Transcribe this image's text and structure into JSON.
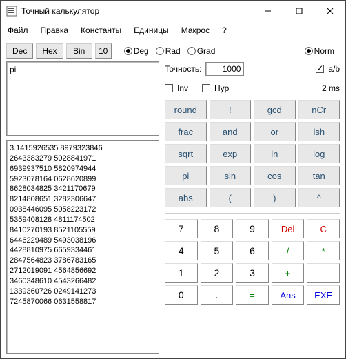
{
  "window": {
    "title": "Точный калькулятор"
  },
  "menu": [
    "Файл",
    "Правка",
    "Константы",
    "Единицы",
    "Макрос",
    "?"
  ],
  "modes": {
    "dec": "Dec",
    "hex": "Hex",
    "bin": "Bin",
    "base": "10"
  },
  "angle": {
    "deg": "Deg",
    "rad": "Rad",
    "grad": "Grad",
    "selected": "deg"
  },
  "norm": {
    "label": "Norm",
    "on": true
  },
  "precision": {
    "label": "Точность:",
    "value": "1000"
  },
  "ab": {
    "label": "a/b",
    "on": true
  },
  "inv": {
    "label": "Inv",
    "on": false
  },
  "hyp": {
    "label": "Hyp",
    "on": false
  },
  "time": "2 ms",
  "expression": "pi",
  "result": "3.1415926535 8979323846\n2643383279 5028841971\n6939937510 5820974944\n5923078164 0628620899\n8628034825 3421170679\n8214808651 3282306647\n0938446095 5058223172\n5359408128 4811174502\n8410270193 8521105559\n6446229489 5493038196\n4428810975 6659334461\n2847564823 3786783165\n2712019091 4564856692\n3460348610 4543266482\n1339360726 0249141273\n7245870066 0631558817",
  "fn": [
    [
      "round",
      "!",
      "gcd",
      "nCr"
    ],
    [
      "frac",
      "and",
      "or",
      "lsh"
    ],
    [
      "sqrt",
      "exp",
      "ln",
      "log"
    ],
    [
      "pi",
      "sin",
      "cos",
      "tan"
    ],
    [
      "abs",
      "(",
      ")",
      "^"
    ]
  ],
  "pad": {
    "r1": [
      "7",
      "8",
      "9",
      "Del",
      "C"
    ],
    "r2": [
      "4",
      "5",
      "6",
      "/",
      "*"
    ],
    "r3": [
      "1",
      "2",
      "3",
      "+",
      "-"
    ],
    "r4": [
      "0",
      ".",
      "=",
      "Ans",
      "EXE"
    ]
  }
}
